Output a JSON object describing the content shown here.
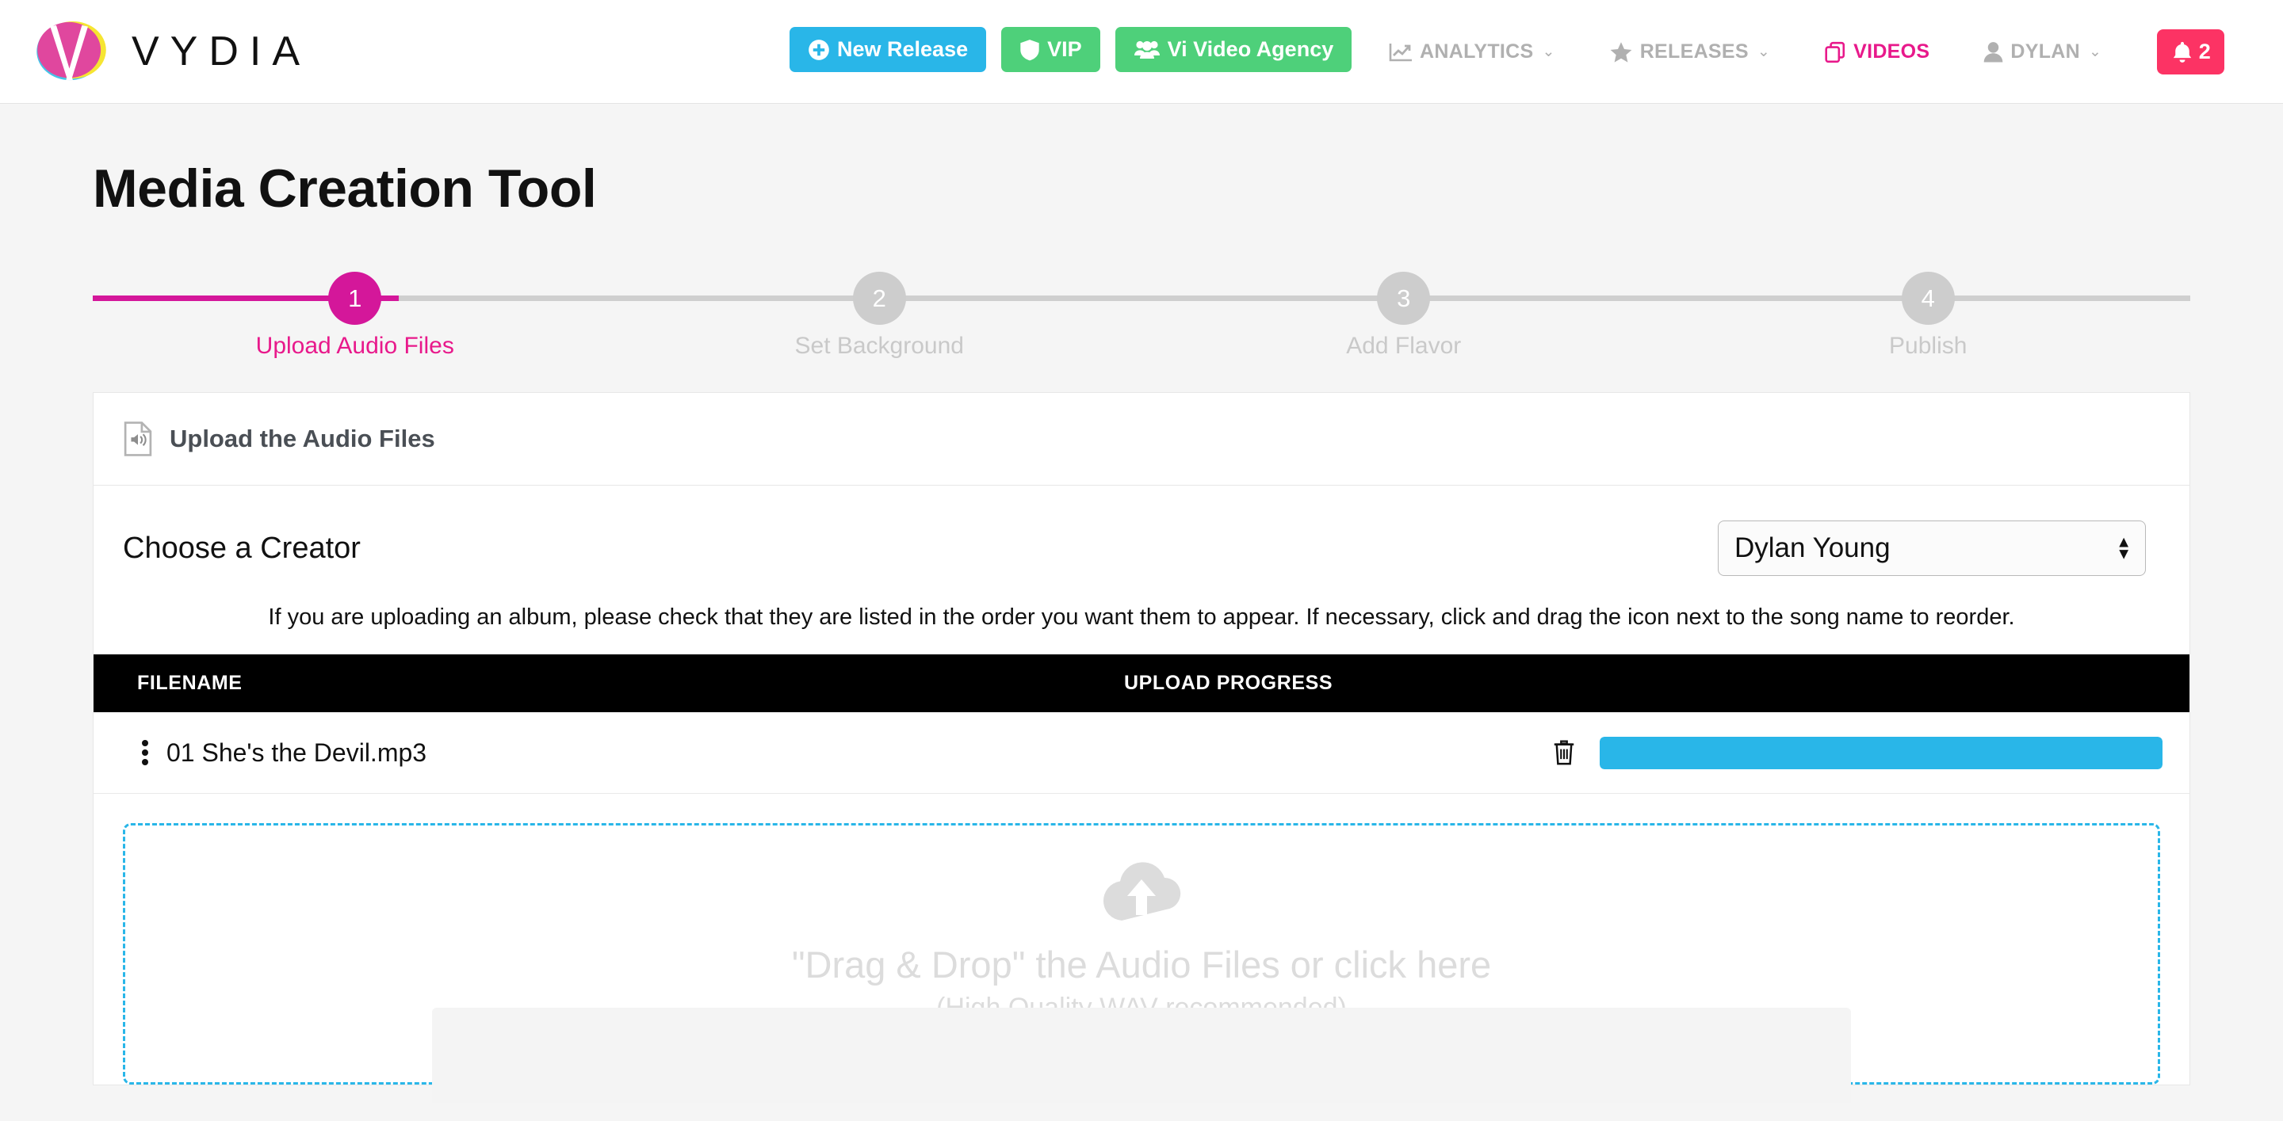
{
  "brand": {
    "name": "VYDIA",
    "logo_icon": "vydia-logo-icon"
  },
  "topnav": {
    "actions": [
      {
        "label": "New Release",
        "icon": "plus-circle-icon",
        "color": "#29b6e8"
      },
      {
        "label": "VIP",
        "icon": "shield-icon",
        "color": "#4ed07a"
      },
      {
        "label": "Vi Video Agency",
        "icon": "users-icon",
        "color": "#4ed07a"
      }
    ],
    "links": [
      {
        "label": "ANALYTICS",
        "icon": "chart-line-icon",
        "caret": "⌄",
        "active": false
      },
      {
        "label": "RELEASES",
        "icon": "star-icon",
        "caret": "⌄",
        "active": false
      },
      {
        "label": "VIDEOS",
        "icon": "copy-files-icon",
        "caret": "",
        "active": true
      },
      {
        "label": "DYLAN",
        "icon": "user-icon",
        "caret": "⌄",
        "active": false
      }
    ],
    "notifications": {
      "icon": "bell-icon",
      "count": "2",
      "color": "#fc3364"
    }
  },
  "page": {
    "title": "Media Creation Tool"
  },
  "steps": {
    "current": 1,
    "fill_percent": "14.6%",
    "items": [
      {
        "number": "1",
        "caption": "Upload Audio Files"
      },
      {
        "number": "2",
        "caption": "Set Background"
      },
      {
        "number": "3",
        "caption": "Add Flavor"
      },
      {
        "number": "4",
        "caption": "Publish"
      }
    ]
  },
  "card": {
    "header": {
      "icon": "audio-file-icon",
      "title": "Upload the Audio Files"
    },
    "creator": {
      "label": "Choose a Creator",
      "selected": "Dylan Young",
      "options": [
        "Dylan Young"
      ]
    },
    "hint": "If you are uploading an album, please check that they are listed in the order you want them to appear. If necessary, click and drag the icon next to the song name to reorder.",
    "table": {
      "columns": [
        "FILENAME",
        "UPLOAD PROGRESS"
      ],
      "rows": [
        {
          "drag_icon": "drag-handle-icon",
          "filename": "01 She's the Devil.mp3",
          "delete_icon": "trash-icon",
          "progress_percent": 100
        }
      ]
    },
    "dropzone": {
      "icon": "cloud-upload-icon",
      "primary": "\"Drag & Drop\" the Audio Files or click here",
      "secondary": "(High Quality WAV recommended)"
    }
  },
  "colors": {
    "brand_magenta": "#e8198b",
    "step_active": "#d4179a",
    "accent_blue": "#29b6e8",
    "accent_green": "#4ed07a",
    "notify_red": "#fc3364",
    "page_bg": "#f5f5f5"
  }
}
